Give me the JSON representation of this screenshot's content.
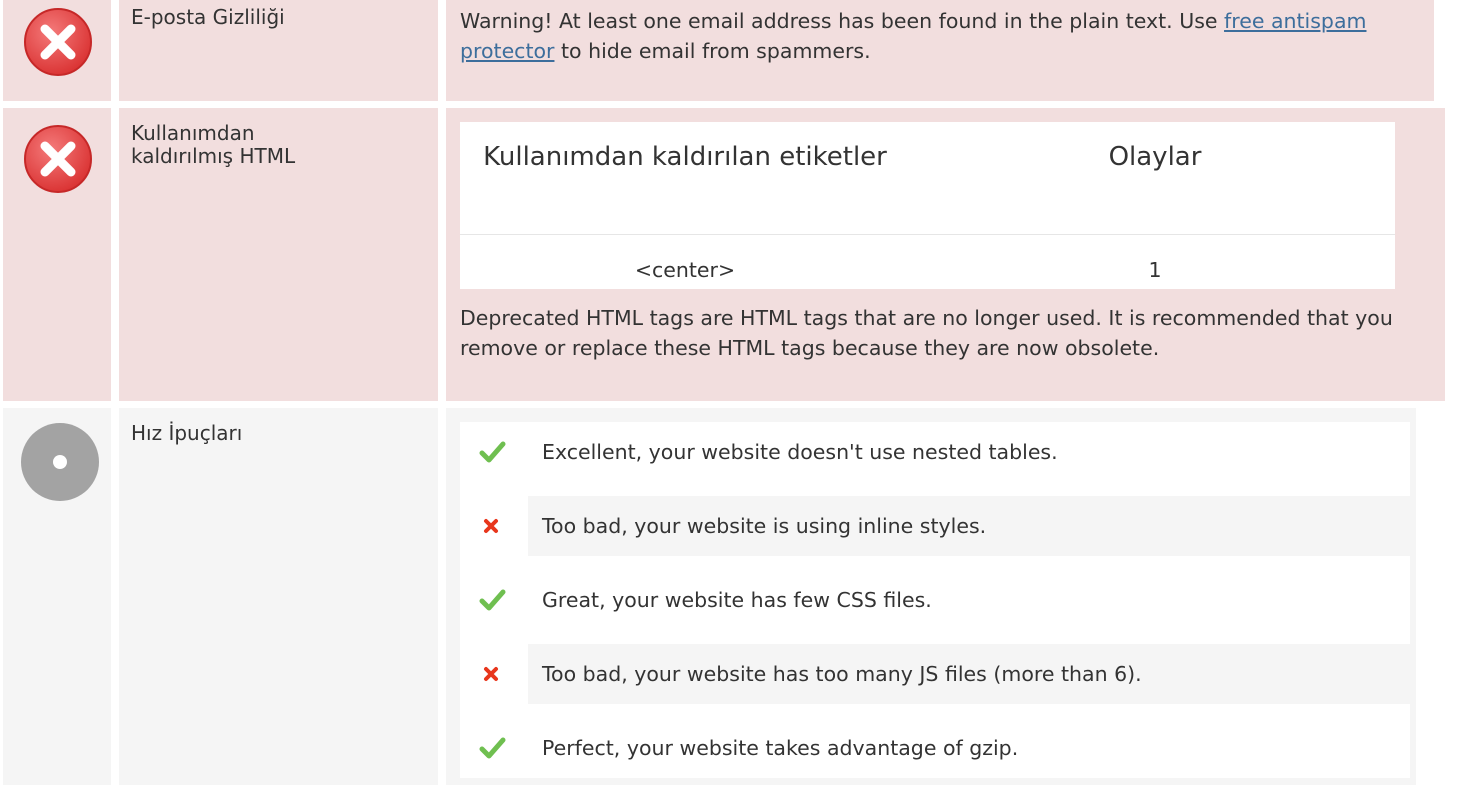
{
  "rows": {
    "email": {
      "status": "error",
      "label": "E-posta Gizliliği",
      "text_before": "Warning! At least one email address has been found in the plain text. Use ",
      "link_text": "free antispam protector",
      "text_after": " to hide email from spammers."
    },
    "deprecated": {
      "status": "error",
      "label_line1": "Kullanımdan",
      "label_line2": "kaldırılmış HTML",
      "table": {
        "headers": [
          "Kullanımdan kaldırılan etiketler",
          "Olaylar"
        ],
        "rows": [
          {
            "tag": "<center>",
            "count": "1"
          }
        ]
      },
      "description": "Deprecated HTML tags are HTML tags that are no longer used. It is recommended that you remove or replace these HTML tags because they are now obsolete."
    },
    "speed": {
      "status": "neutral",
      "label": "Hız İpuçları",
      "tips": [
        {
          "status": "good",
          "icon": "check-icon",
          "text": "Excellent, your website doesn't use nested tables."
        },
        {
          "status": "bad",
          "icon": "cross-icon",
          "text": "Too bad, your website is using inline styles."
        },
        {
          "status": "good",
          "icon": "check-icon",
          "text": "Great, your website has few CSS files."
        },
        {
          "status": "bad",
          "icon": "cross-icon",
          "text": "Too bad, your website has too many JS files (more than 6)."
        },
        {
          "status": "good",
          "icon": "check-icon",
          "text": "Perfect, your website takes advantage of gzip."
        }
      ]
    }
  },
  "colors": {
    "error_bg": "#f2dede",
    "neutral_bg": "#f5f5f5",
    "error_icon": "#e04040",
    "neutral_icon": "#a3a3a3",
    "check": "#6fbf50",
    "cross": "#e8361c",
    "link": "#3d6e9c"
  }
}
